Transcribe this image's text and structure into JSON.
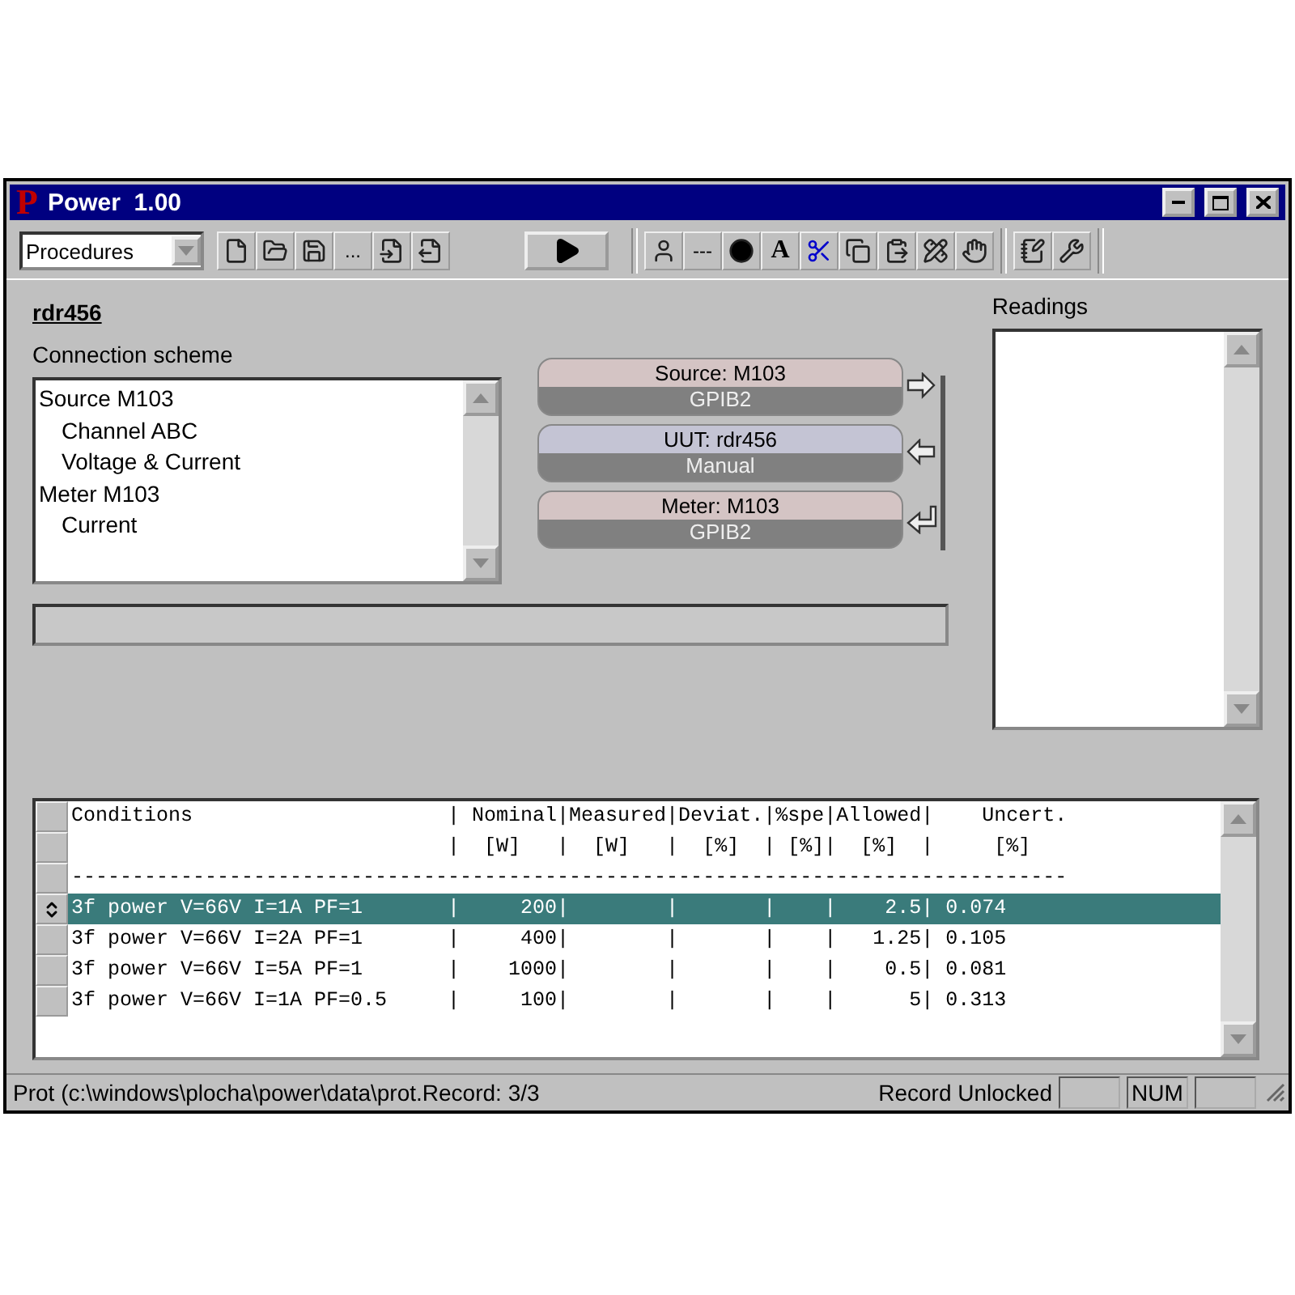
{
  "window": {
    "icon_letter": "P",
    "title": "Power  1.00"
  },
  "toolbar": {
    "combo": {
      "value": "Procedures"
    },
    "file_buttons": [
      {
        "kind": "new"
      },
      {
        "kind": "open"
      },
      {
        "kind": "save"
      },
      {
        "kind": "text",
        "label": "..."
      },
      {
        "kind": "import"
      },
      {
        "kind": "export"
      }
    ],
    "run_button": {
      "kind": "play"
    },
    "edit_buttons": [
      {
        "kind": "head"
      },
      {
        "kind": "text",
        "label": "---"
      },
      {
        "kind": "dot"
      },
      {
        "kind": "text",
        "label": "A"
      },
      {
        "kind": "cut"
      },
      {
        "kind": "copy"
      },
      {
        "kind": "paste"
      },
      {
        "kind": "edit"
      },
      {
        "kind": "hand"
      },
      {
        "kind": "notes"
      },
      {
        "kind": "wrench"
      }
    ]
  },
  "unit": {
    "name": "rdr456"
  },
  "connection_scheme": {
    "label": "Connection scheme",
    "items": [
      {
        "label": "Source M103",
        "children": [
          {
            "label": "Channel ABC"
          },
          {
            "label": "Voltage & Current"
          }
        ]
      },
      {
        "label": "Meter M103",
        "children": [
          {
            "label": "Current"
          }
        ]
      }
    ]
  },
  "devices": [
    {
      "title": "Source: M103",
      "port": "GPIB2",
      "color": "#d4c4c4",
      "kind": "right"
    },
    {
      "title": "UUT: rdr456",
      "port": "Manual",
      "color": "#c4c4d4",
      "kind": "left"
    },
    {
      "title": "Meter: M103",
      "port": "GPIB2",
      "color": "#d4c4c4",
      "kind": "return"
    }
  ],
  "readings": {
    "label": "Readings"
  },
  "table": {
    "lines": [
      {
        "text": "Conditions                     | Nominal|Measured|Deviat.|%spe|Allowed|    Uncert.",
        "selected": false
      },
      {
        "text": "                               |  [W]   |  [W]   |  [%]  | [%]|  [%]  |     [%]",
        "selected": false
      },
      {
        "text": "----------------------------------------------------------------------------------",
        "selected": false
      },
      {
        "text": "3f power V=66V I=1A PF=1       |     200|        |       |    |    2.5| 0.074",
        "selected": true
      },
      {
        "text": "3f power V=66V I=2A PF=1       |     400|        |       |    |   1.25| 0.105",
        "selected": false
      },
      {
        "text": "3f power V=66V I=5A PF=1       |    1000|        |       |    |    0.5| 0.081",
        "selected": false
      },
      {
        "text": "3f power V=66V I=1A PF=0.5     |     100|        |       |    |      5| 0.313",
        "selected": false
      }
    ]
  },
  "status_bar": {
    "path": "Prot (c:\\windows\\plocha\\power\\data\\prot.",
    "record": "Record: 3/3",
    "lock": "Record Unlocked",
    "indicator": "NUM"
  }
}
